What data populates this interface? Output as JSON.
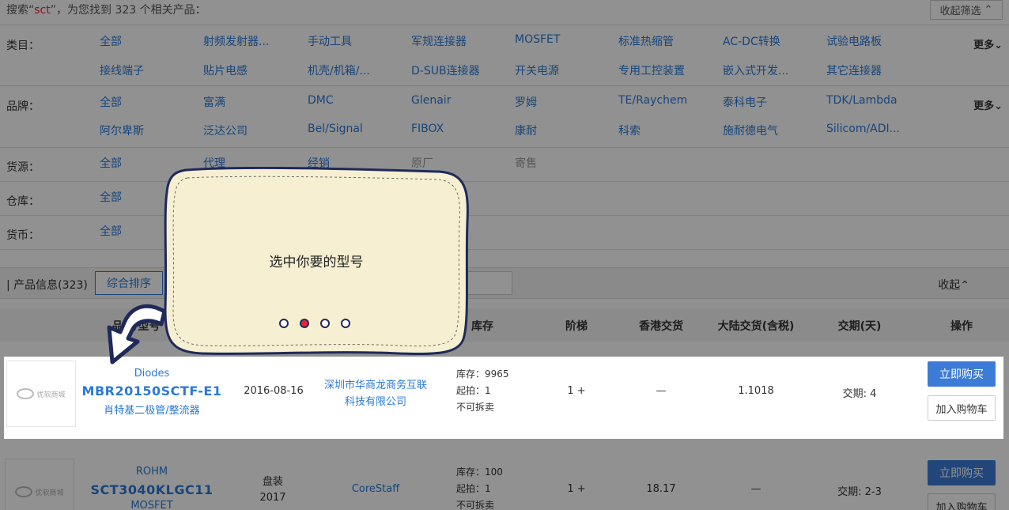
{
  "search": {
    "prefix": "搜索“",
    "keyword": "sct",
    "suffix": "”，为您找到 323 个相关产品：",
    "collapse_label": "收起筛选",
    "collapse_icon": "chevron-up-icon"
  },
  "filters": [
    {
      "label": "类目：",
      "more": "更多",
      "options": [
        "全部",
        "射频发射器...",
        "手动工具",
        "军规连接器",
        "MOSFET",
        "标准热缩管",
        "AC-DC转换",
        "试验电路板",
        "接线端子",
        "贴片电感",
        "机壳/机箱/...",
        "D-SUB连接器",
        "开关电源",
        "专用工控装置",
        "嵌入式开发...",
        "其它连接器"
      ]
    },
    {
      "label": "品牌：",
      "more": "更多",
      "options": [
        "全部",
        "富满",
        "DMC",
        "Glenair",
        "罗姆",
        "TE/Raychem",
        "泰科电子",
        "TDK/Lambda",
        "阿尔卑斯",
        "泛达公司",
        "Bel/Signal",
        "FIBOX",
        "康耐",
        "科索",
        "施耐德电气",
        "Silicom/ADI..."
      ]
    },
    {
      "label": "货源：",
      "options": [
        "全部",
        "代理",
        "经销",
        "原厂",
        "寄售"
      ]
    },
    {
      "label": "仓库：",
      "options": [
        "全部"
      ]
    },
    {
      "label": "货币：",
      "options": [
        "全部"
      ]
    }
  ],
  "product_bar": {
    "title": "| 产品信息(323)",
    "sort_label": "综合排序",
    "collapse_label": "收起"
  },
  "table_header": {
    "model": "品牌/型号",
    "stock": "库存",
    "tier": "阶梯",
    "hk": "香港交货",
    "mainland": "大陆交货(含税)",
    "lead": "交期(天)",
    "action": "操作"
  },
  "products": [
    {
      "brand": "Diodes",
      "model": "MBR20150SCTF-E1",
      "category": "肖特基二极管/整流器",
      "date_line1": "2016-08-16",
      "date_line2": "",
      "supplier_line1": "深圳市华商龙商务互联",
      "supplier_line2": "科技有限公司",
      "stock": "库存：9965",
      "moq": "起拍：1",
      "split": "不可拆卖",
      "tier": "1 +",
      "hk": "—",
      "mainland": "1.1018",
      "lead": "交期: 4",
      "buy": "立即购买",
      "cart": "加入购物车",
      "logo_text": "优软商城"
    },
    {
      "brand": "ROHM",
      "model": "SCT3040KLGC11",
      "category": "MOSFET",
      "date_line1": "盘装",
      "date_line2": "2017",
      "supplier_line1": "CoreStaff",
      "supplier_line2": "",
      "stock": "库存：100",
      "moq": "起拍：1",
      "split": "不可拆卖",
      "tier": "1 +",
      "hk": "18.17",
      "mainland": "—",
      "lead": "交期: 2-3",
      "buy": "立即购买",
      "cart": "加入购物车",
      "logo_text": "优软商城"
    }
  ],
  "tooltip": {
    "text": "选中你要的型号",
    "steps": 4,
    "active_step": 2
  },
  "colors": {
    "accent": "#2a7ad8",
    "button": "#3d7cd6",
    "keyword": "#ee2233",
    "tooltip_bg": "#f6efd2"
  }
}
